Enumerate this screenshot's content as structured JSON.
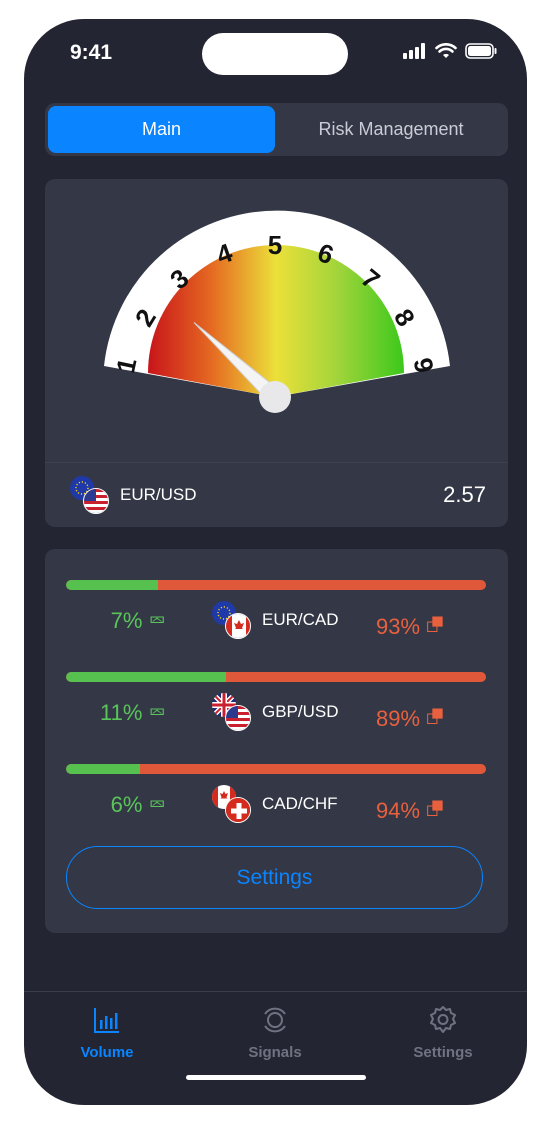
{
  "status": {
    "time": "9:41"
  },
  "segment": {
    "main": "Main",
    "risk": "Risk Management"
  },
  "gauge": {
    "numbers": [
      "1",
      "2",
      "3",
      "4",
      "5",
      "6",
      "7",
      "8",
      "9"
    ],
    "pair": "EUR/USD",
    "value": "2.57",
    "needle_value": 2.57
  },
  "pairs": [
    {
      "name": "EUR/CAD",
      "buy": "7%",
      "sell": "93%",
      "buy_fraction": 0.22
    },
    {
      "name": "GBP/USD",
      "buy": "11%",
      "sell": "89%",
      "buy_fraction": 0.38
    },
    {
      "name": "CAD/CHF",
      "buy": "6%",
      "sell": "94%",
      "buy_fraction": 0.175
    }
  ],
  "settings_button": "Settings",
  "tabs": {
    "volume": "Volume",
    "signals": "Signals",
    "settings": "Settings"
  },
  "colors": {
    "accent": "#0a84ff",
    "buy": "#5ac45a",
    "sell": "#e8603e",
    "background": "#232632",
    "card": "#343846"
  }
}
